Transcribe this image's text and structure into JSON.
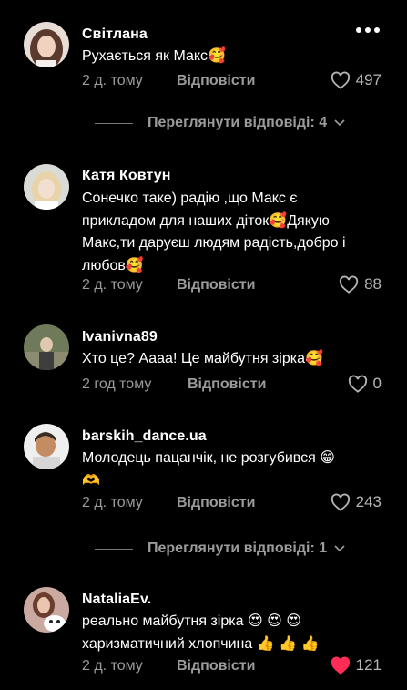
{
  "comments": [
    {
      "username": "Світлана",
      "text": "Рухається як Макс🥰",
      "time": "2 д. тому",
      "reply_label": "Відповісти",
      "likes": "497",
      "liked": false
    },
    {
      "username": "Катя Ковтун",
      "text": "Сонечко таке) радію ,що Макс є прикладом для наших діток🥰Дякую Макс,ти даруєш людям радість,добро і любов🥰",
      "time": "2 д. тому",
      "reply_label": "Відповісти",
      "likes": "88",
      "liked": false
    },
    {
      "username": "Ivanivna89",
      "text": "Хто це? Аааа! Це майбутня зірка🥰",
      "time": "2 год тому",
      "reply_label": "Відповісти",
      "likes": "0",
      "liked": false
    },
    {
      "username": "barskih_dance.ua",
      "text": "Молодець пацанчік, не розгубився 😁 🫶",
      "time": "2 д. тому",
      "reply_label": "Відповісти",
      "likes": "243",
      "liked": false
    },
    {
      "username": "NataliaEv.",
      "text": "реально майбутня зірка 😍 😍 😍 харизматичний хлопчина 👍 👍 👍",
      "time": "2 д. тому",
      "reply_label": "Відповісти",
      "likes": "121",
      "liked": true
    }
  ],
  "view_replies": [
    {
      "label": "Переглянути відповіді: 4"
    },
    {
      "label": "Переглянути відповіді: 1"
    }
  ],
  "colors": {
    "background": "#000000",
    "secondary_text": "#9b9b9b",
    "liked_heart": "#ff2d55"
  },
  "icons": {
    "more": "more-horizontal-icon",
    "like": "heart-icon",
    "expand": "chevron-down-icon"
  }
}
